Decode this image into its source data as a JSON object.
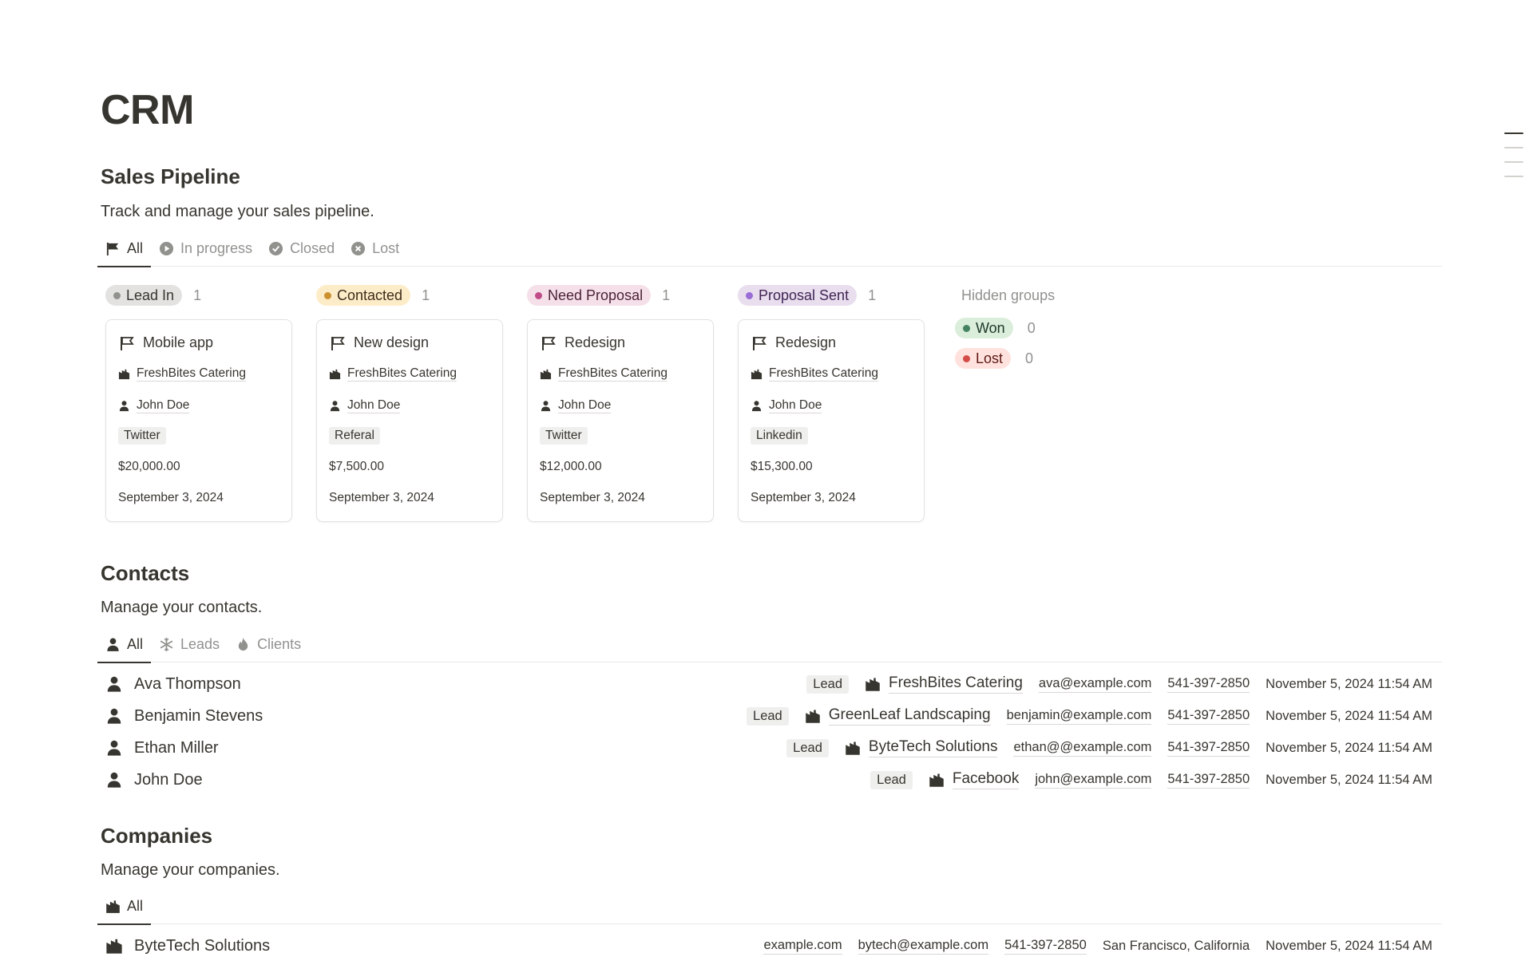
{
  "page": {
    "title": "CRM"
  },
  "pipeline": {
    "title": "Sales Pipeline",
    "description": "Track and manage your sales pipeline.",
    "tabs": [
      {
        "label": "All",
        "icon": "flag-icon",
        "active": true
      },
      {
        "label": "In progress",
        "icon": "play-circle-icon",
        "active": false
      },
      {
        "label": "Closed",
        "icon": "check-circle-icon",
        "active": false
      },
      {
        "label": "Lost",
        "icon": "x-circle-icon",
        "active": false
      }
    ],
    "columns": [
      {
        "label": "Lead In",
        "count": "1",
        "bg": "#e3e2e0",
        "dot": "#91918e",
        "text": "#37352f",
        "card": {
          "title": "Mobile app",
          "company": "FreshBites Catering",
          "contact": "John Doe",
          "source": "Twitter",
          "value": "$20,000.00",
          "date": "September 3, 2024"
        }
      },
      {
        "label": "Contacted",
        "count": "1",
        "bg": "#fdecc8",
        "dot": "#cb912f",
        "text": "#402c1b",
        "card": {
          "title": "New design",
          "company": "FreshBites Catering",
          "contact": "John Doe",
          "source": "Referal",
          "value": "$7,500.00",
          "date": "September 3, 2024"
        }
      },
      {
        "label": "Need Proposal",
        "count": "1",
        "bg": "#f5e0e9",
        "dot": "#c14c8a",
        "text": "#4c2337",
        "card": {
          "title": "Redesign",
          "company": "FreshBites Catering",
          "contact": "John Doe",
          "source": "Twitter",
          "value": "$12,000.00",
          "date": "September 3, 2024"
        }
      },
      {
        "label": "Proposal Sent",
        "count": "1",
        "bg": "#e8deee",
        "dot": "#9a6dd7",
        "text": "#412454",
        "card": {
          "title": "Redesign",
          "company": "FreshBites Catering",
          "contact": "John Doe",
          "source": "Linkedin",
          "value": "$15,300.00",
          "date": "September 3, 2024"
        }
      }
    ],
    "hidden_groups": {
      "title": "Hidden groups",
      "items": [
        {
          "label": "Won",
          "count": "0",
          "bg": "#dbeddb",
          "dot": "#448361",
          "text": "#1c3829"
        },
        {
          "label": "Lost",
          "count": "0",
          "bg": "#ffe2dd",
          "dot": "#d44c47",
          "text": "#5d1715"
        }
      ]
    }
  },
  "contacts": {
    "title": "Contacts",
    "description": "Manage your contacts.",
    "tabs": [
      {
        "label": "All",
        "icon": "person-icon",
        "active": true
      },
      {
        "label": "Leads",
        "icon": "snowflake-icon",
        "active": false
      },
      {
        "label": "Clients",
        "icon": "flame-icon",
        "active": false
      }
    ],
    "rows": [
      {
        "name": "Ava Thompson",
        "type": "Lead",
        "company": "FreshBites Catering",
        "email": "ava@example.com",
        "phone": "541-397-2850",
        "created": "November 5, 2024 11:54 AM"
      },
      {
        "name": "Benjamin Stevens",
        "type": "Lead",
        "company": "GreenLeaf Landscaping",
        "email": "benjamin@example.com",
        "phone": "541-397-2850",
        "created": "November 5, 2024 11:54 AM"
      },
      {
        "name": "Ethan Miller",
        "type": "Lead",
        "company": "ByteTech Solutions",
        "email": "ethan@@example.com",
        "phone": "541-397-2850",
        "created": "November 5, 2024 11:54 AM"
      },
      {
        "name": "John Doe",
        "type": "Lead",
        "company": "Facebook",
        "email": "john@example.com",
        "phone": "541-397-2850",
        "created": "November 5, 2024 11:54 AM"
      }
    ]
  },
  "companies": {
    "title": "Companies",
    "description": "Manage your companies.",
    "tabs": [
      {
        "label": "All",
        "icon": "building-icon",
        "active": true
      }
    ],
    "rows": [
      {
        "name": "ByteTech Solutions",
        "website": "example.com",
        "email": "bytech@example.com",
        "phone": "541-397-2850",
        "location": "San Francisco, California",
        "created": "November 5, 2024 11:54 AM"
      }
    ]
  }
}
